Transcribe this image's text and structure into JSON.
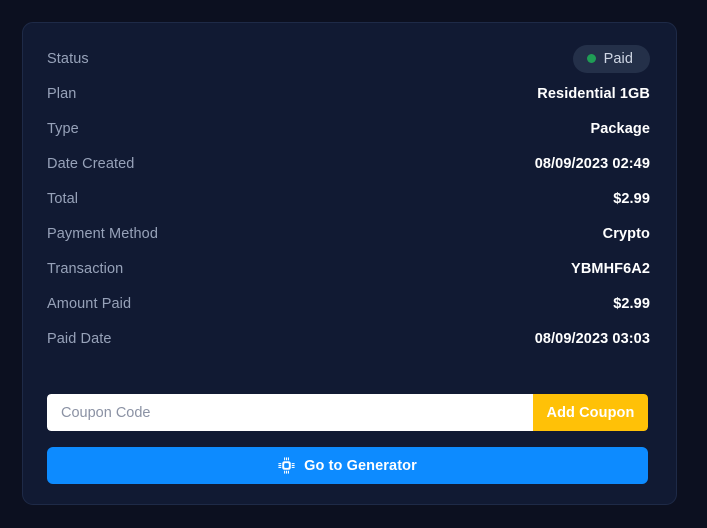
{
  "card": {
    "details": [
      {
        "label": "Status",
        "value": "",
        "type": "badge"
      },
      {
        "label": "Plan",
        "value": "Residential 1GB",
        "type": "text"
      },
      {
        "label": "Type",
        "value": "Package",
        "type": "text"
      },
      {
        "label": "Date Created",
        "value": "08/09/2023 02:49",
        "type": "text"
      },
      {
        "label": "Total",
        "value": "$2.99",
        "type": "text"
      },
      {
        "label": "Payment Method",
        "value": "Crypto",
        "type": "text"
      },
      {
        "label": "Transaction",
        "value": "YBMHF6A2",
        "type": "text"
      },
      {
        "label": "Amount Paid",
        "value": "$2.99",
        "type": "text"
      },
      {
        "label": "Paid Date",
        "value": "08/09/2023 03:03",
        "type": "text"
      }
    ],
    "status_badge": {
      "text": "Paid",
      "dot_icon": "status-dot-icon",
      "dot_color": "#1f9d55",
      "background": "#243049"
    },
    "coupon": {
      "placeholder": "Coupon Code",
      "value": "",
      "button_label": "Add Coupon",
      "button_color": "#ffc107"
    },
    "generator": {
      "label": "Go to Generator",
      "icon": "microchip-icon",
      "color": "#0d8bff"
    }
  }
}
